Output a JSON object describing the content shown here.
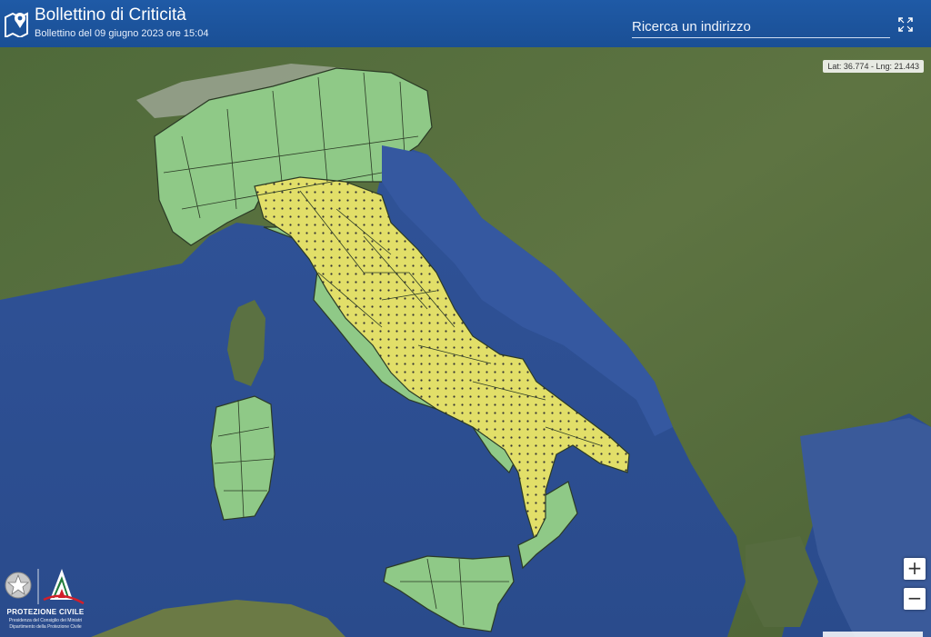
{
  "header": {
    "title": "Bollettino di Criticità",
    "subtitle": "Bollettino del 09 giugno 2023 ore 15:04",
    "search_placeholder": "Ricerca un indirizzo"
  },
  "map": {
    "coords_readout": "Lat: 36.774 - Lng: 21.443",
    "zoom_in_label": "+",
    "zoom_out_label": "−",
    "alert_colors": {
      "green": "#8fc987",
      "yellow": "#e7e36a"
    },
    "legend_regions": [
      "green",
      "yellow"
    ]
  },
  "brand": {
    "name": "PROTEZIONE CIVILE",
    "sub1": "Presidenza del Consiglio dei Ministri",
    "sub2": "Dipartimento della Protezione Civile"
  }
}
